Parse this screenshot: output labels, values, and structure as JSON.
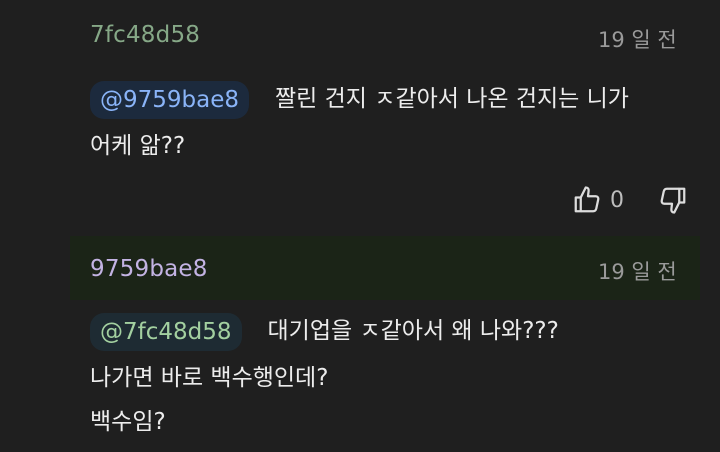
{
  "comments": [
    {
      "username": "7fc48d58",
      "timestamp": "19 일 전",
      "mention": "@9759bae8",
      "line1": "짤린 건지 ㅈ같아서 나온 건지는 니가",
      "line2": "어케 앎??",
      "like_count": "0"
    },
    {
      "username": "9759bae8",
      "timestamp": "19 일 전",
      "mention": "@7fc48d58",
      "line1": "대기업을 ㅈ같아서 왜 나와???",
      "line2": "나가면 바로 백수행인데?",
      "line3": "백수임?"
    }
  ],
  "colors": {
    "username_green": "#86a887",
    "username_purple": "#c3b3e3",
    "mention_blue": "#8ab4f8",
    "mention_green": "#a3d0a0",
    "highlight_bg": "#1b2417"
  },
  "icons": {
    "like": "thumbs-up-icon",
    "dislike": "thumbs-down-icon"
  }
}
